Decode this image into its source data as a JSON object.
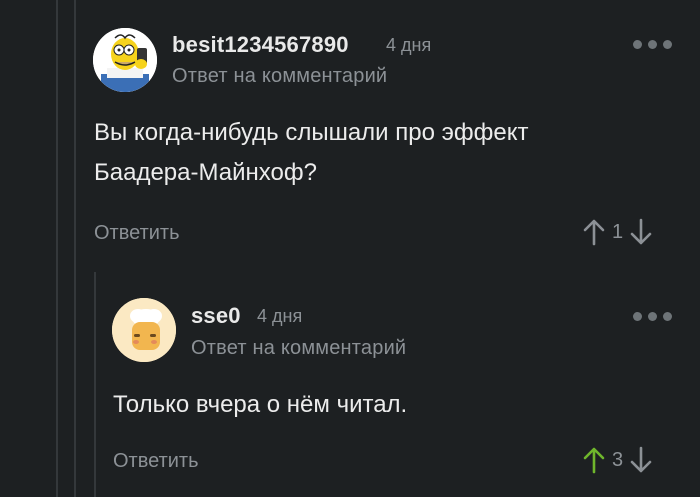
{
  "comments": [
    {
      "author": "besit1234567890",
      "time": "4 дня",
      "reply_to": "Ответ на комментарий",
      "text_lines": [
        "Вы когда-нибудь слышали про эффект",
        "Баадера-Майнхоф?"
      ],
      "reply_label": "Ответить",
      "rating": "1",
      "upvoted": false,
      "avatar_icon": "simpsons-character-avatar"
    },
    {
      "author": "sse0",
      "time": "4 дня",
      "reply_to": "Ответ на комментарий",
      "text_lines": [
        "Только вчера о нём читал."
      ],
      "reply_label": "Ответить",
      "rating": "3",
      "upvoted": true,
      "avatar_icon": "cute-chef-avatar"
    }
  ],
  "colors": {
    "background": "#1d2022",
    "upvote_active": "#6fb62c",
    "muted": "#8c9196"
  }
}
